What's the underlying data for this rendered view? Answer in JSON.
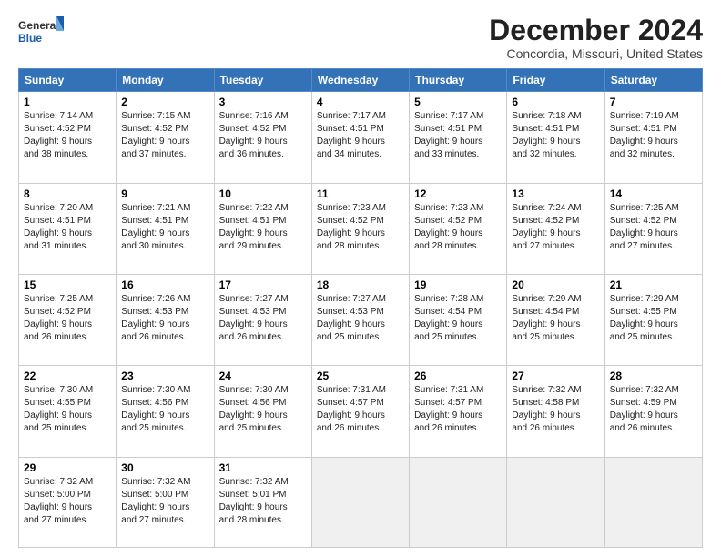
{
  "logo": {
    "line1": "General",
    "line2": "Blue"
  },
  "title": "December 2024",
  "subtitle": "Concordia, Missouri, United States",
  "days_of_week": [
    "Sunday",
    "Monday",
    "Tuesday",
    "Wednesday",
    "Thursday",
    "Friday",
    "Saturday"
  ],
  "weeks": [
    [
      {
        "day": 1,
        "info": "Sunrise: 7:14 AM\nSunset: 4:52 PM\nDaylight: 9 hours\nand 38 minutes."
      },
      {
        "day": 2,
        "info": "Sunrise: 7:15 AM\nSunset: 4:52 PM\nDaylight: 9 hours\nand 37 minutes."
      },
      {
        "day": 3,
        "info": "Sunrise: 7:16 AM\nSunset: 4:52 PM\nDaylight: 9 hours\nand 36 minutes."
      },
      {
        "day": 4,
        "info": "Sunrise: 7:17 AM\nSunset: 4:51 PM\nDaylight: 9 hours\nand 34 minutes."
      },
      {
        "day": 5,
        "info": "Sunrise: 7:17 AM\nSunset: 4:51 PM\nDaylight: 9 hours\nand 33 minutes."
      },
      {
        "day": 6,
        "info": "Sunrise: 7:18 AM\nSunset: 4:51 PM\nDaylight: 9 hours\nand 32 minutes."
      },
      {
        "day": 7,
        "info": "Sunrise: 7:19 AM\nSunset: 4:51 PM\nDaylight: 9 hours\nand 32 minutes."
      }
    ],
    [
      {
        "day": 8,
        "info": "Sunrise: 7:20 AM\nSunset: 4:51 PM\nDaylight: 9 hours\nand 31 minutes."
      },
      {
        "day": 9,
        "info": "Sunrise: 7:21 AM\nSunset: 4:51 PM\nDaylight: 9 hours\nand 30 minutes."
      },
      {
        "day": 10,
        "info": "Sunrise: 7:22 AM\nSunset: 4:51 PM\nDaylight: 9 hours\nand 29 minutes."
      },
      {
        "day": 11,
        "info": "Sunrise: 7:23 AM\nSunset: 4:52 PM\nDaylight: 9 hours\nand 28 minutes."
      },
      {
        "day": 12,
        "info": "Sunrise: 7:23 AM\nSunset: 4:52 PM\nDaylight: 9 hours\nand 28 minutes."
      },
      {
        "day": 13,
        "info": "Sunrise: 7:24 AM\nSunset: 4:52 PM\nDaylight: 9 hours\nand 27 minutes."
      },
      {
        "day": 14,
        "info": "Sunrise: 7:25 AM\nSunset: 4:52 PM\nDaylight: 9 hours\nand 27 minutes."
      }
    ],
    [
      {
        "day": 15,
        "info": "Sunrise: 7:25 AM\nSunset: 4:52 PM\nDaylight: 9 hours\nand 26 minutes."
      },
      {
        "day": 16,
        "info": "Sunrise: 7:26 AM\nSunset: 4:53 PM\nDaylight: 9 hours\nand 26 minutes."
      },
      {
        "day": 17,
        "info": "Sunrise: 7:27 AM\nSunset: 4:53 PM\nDaylight: 9 hours\nand 26 minutes."
      },
      {
        "day": 18,
        "info": "Sunrise: 7:27 AM\nSunset: 4:53 PM\nDaylight: 9 hours\nand 25 minutes."
      },
      {
        "day": 19,
        "info": "Sunrise: 7:28 AM\nSunset: 4:54 PM\nDaylight: 9 hours\nand 25 minutes."
      },
      {
        "day": 20,
        "info": "Sunrise: 7:29 AM\nSunset: 4:54 PM\nDaylight: 9 hours\nand 25 minutes."
      },
      {
        "day": 21,
        "info": "Sunrise: 7:29 AM\nSunset: 4:55 PM\nDaylight: 9 hours\nand 25 minutes."
      }
    ],
    [
      {
        "day": 22,
        "info": "Sunrise: 7:30 AM\nSunset: 4:55 PM\nDaylight: 9 hours\nand 25 minutes."
      },
      {
        "day": 23,
        "info": "Sunrise: 7:30 AM\nSunset: 4:56 PM\nDaylight: 9 hours\nand 25 minutes."
      },
      {
        "day": 24,
        "info": "Sunrise: 7:30 AM\nSunset: 4:56 PM\nDaylight: 9 hours\nand 25 minutes."
      },
      {
        "day": 25,
        "info": "Sunrise: 7:31 AM\nSunset: 4:57 PM\nDaylight: 9 hours\nand 26 minutes."
      },
      {
        "day": 26,
        "info": "Sunrise: 7:31 AM\nSunset: 4:57 PM\nDaylight: 9 hours\nand 26 minutes."
      },
      {
        "day": 27,
        "info": "Sunrise: 7:32 AM\nSunset: 4:58 PM\nDaylight: 9 hours\nand 26 minutes."
      },
      {
        "day": 28,
        "info": "Sunrise: 7:32 AM\nSunset: 4:59 PM\nDaylight: 9 hours\nand 26 minutes."
      }
    ],
    [
      {
        "day": 29,
        "info": "Sunrise: 7:32 AM\nSunset: 5:00 PM\nDaylight: 9 hours\nand 27 minutes."
      },
      {
        "day": 30,
        "info": "Sunrise: 7:32 AM\nSunset: 5:00 PM\nDaylight: 9 hours\nand 27 minutes."
      },
      {
        "day": 31,
        "info": "Sunrise: 7:32 AM\nSunset: 5:01 PM\nDaylight: 9 hours\nand 28 minutes."
      },
      null,
      null,
      null,
      null
    ]
  ]
}
